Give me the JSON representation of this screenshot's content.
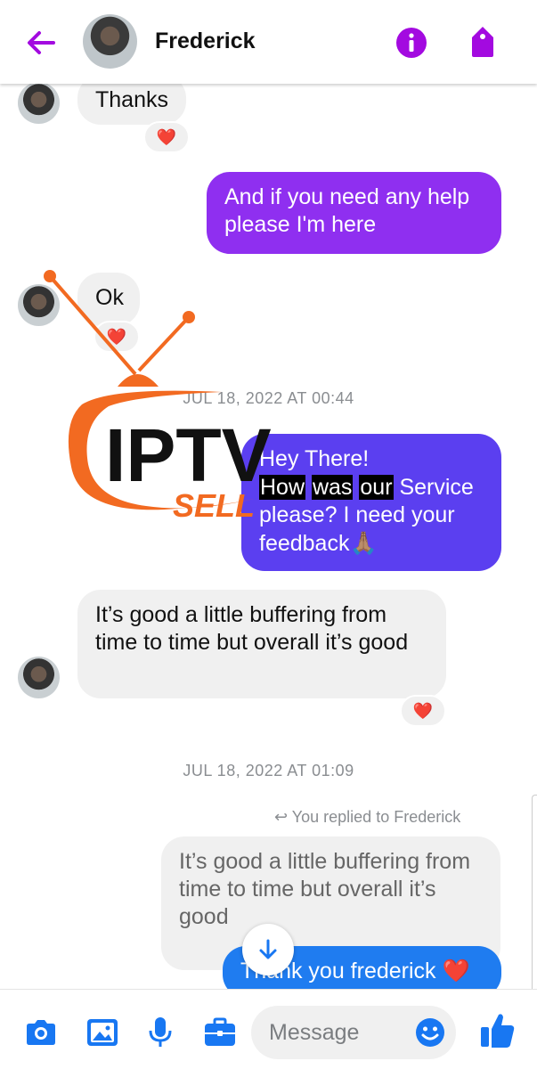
{
  "header": {
    "contact_name": "Frederick",
    "back_icon": "arrow-left-icon",
    "info_icon": "info-circle-icon",
    "tag_icon": "tag-icon",
    "accent": "#a30ae0"
  },
  "messages": [
    {
      "id": "m1",
      "from": "contact",
      "text": "Thanks",
      "reaction": "❤️"
    },
    {
      "id": "m2",
      "from": "me",
      "text": "And if you need any help please I'm here"
    },
    {
      "id": "m3",
      "from": "contact",
      "text": "Ok",
      "reaction": "❤️"
    },
    {
      "id": "ts1",
      "type": "timestamp",
      "text": "JUL 18, 2022 AT 00:44"
    },
    {
      "id": "m4",
      "from": "me",
      "line1": "Hey There!",
      "line2_words": [
        "How",
        "was",
        "our"
      ],
      "line2_rest": " Service",
      "line3": "please? I need your",
      "line4": "feedback🙏🏽"
    },
    {
      "id": "m5",
      "from": "contact",
      "text": "It’s good a little buffering from time to time but overall it’s good",
      "reaction": "❤️"
    },
    {
      "id": "ts2",
      "type": "timestamp",
      "text": "JUL 18, 2022 AT 01:09"
    },
    {
      "id": "r1",
      "type": "reply-label",
      "text": "You replied to Frederick"
    },
    {
      "id": "q1",
      "type": "reply-quote",
      "text": "It’s good a little buffering from time to time but overall it’s good"
    },
    {
      "id": "m6",
      "from": "me",
      "text": "Thank you frederick ❤️"
    }
  ],
  "watermark": {
    "line1": "IPTV",
    "line2": "SELL",
    "accent": "#f26a21"
  },
  "composer": {
    "placeholder": "Message",
    "camera_icon": "camera-icon",
    "gallery_icon": "image-icon",
    "mic_icon": "microphone-icon",
    "briefcase_icon": "briefcase-icon",
    "emoji_icon": "smiley-icon",
    "like_icon": "thumbs-up-icon",
    "accent": "#1877f2"
  }
}
